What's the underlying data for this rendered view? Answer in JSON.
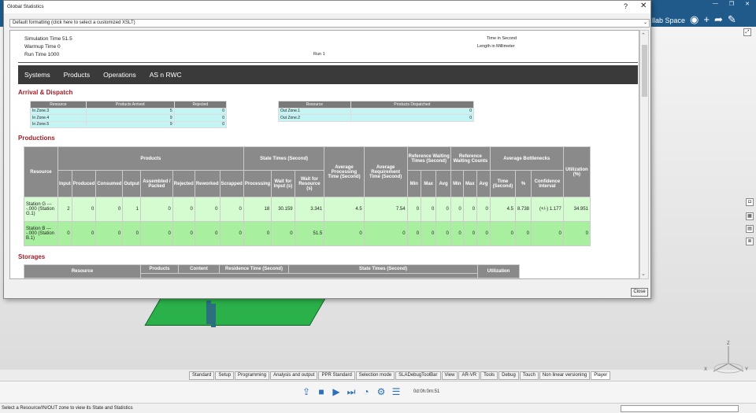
{
  "app": {
    "title_fragment": "llab Space",
    "header_icons": [
      "user-icon",
      "plus-icon",
      "share-icon",
      "tools-icon"
    ]
  },
  "dialog": {
    "title": "Global Statistics",
    "help_label": "?",
    "close_label": "✕",
    "xslt_selector": "Default formatting (click here to select a customized XSLT)",
    "close_button": "Close"
  },
  "report": {
    "simulation_time": "Simulation Time 51.5",
    "warmup_time": "Warmup Time 0",
    "run_time": "Run Time 1000",
    "run": "Run 1",
    "time_unit": "Time in Second",
    "length_unit": "Length in Millimeter",
    "nav": [
      "Systems",
      "Products",
      "Operations",
      "AS n RWC"
    ],
    "sections": {
      "arrival": "Arrival & Dispatch",
      "productions": "Productions",
      "storages": "Storages"
    },
    "arrival_table": {
      "headers": [
        "Resource",
        "Products Arrived",
        "Rejected"
      ],
      "rows": [
        [
          "In Zone.3",
          "5",
          "0"
        ],
        [
          "In Zone.4",
          "9",
          "0"
        ],
        [
          "In Zone.5",
          "9",
          "0"
        ]
      ]
    },
    "dispatch_table": {
      "headers": [
        "Resource",
        "Products Dispatched"
      ],
      "rows": [
        [
          "Out Zone.1",
          "0"
        ],
        [
          "Out Zone.2",
          "0"
        ]
      ]
    },
    "production_table": {
      "group_headers": {
        "resource": "Resource",
        "products": "Products",
        "state_times": "State Times (Second)",
        "avg_processing": "Average Processing Time (Second)",
        "avg_requirement": "Average Requirement Time (Second)",
        "ref_wait_times": "Reference Waiting Times (Second)",
        "ref_wait_counts": "Reference Waiting Counts",
        "avg_bottlenecks": "Average Bottlenecks",
        "utilization": "Utilization (%)"
      },
      "sub_headers": {
        "products": [
          "Input",
          "Produced",
          "Consumed",
          "Output",
          "Assembled / Packed",
          "Rejected",
          "Reworked",
          "Scrapped"
        ],
        "state_times": [
          "Processing",
          "Wait for Input (s)",
          "Wait for Resource (s)"
        ],
        "ref_wait_times": [
          "Min",
          "Max",
          "Avg"
        ],
        "ref_wait_counts": [
          "Min",
          "Max",
          "Avg"
        ],
        "avg_bottlenecks": [
          "Time (Second)",
          "%",
          "Confidence Interval"
        ]
      },
      "rows": [
        {
          "resource": "Station G ----.000 (Station G.1)",
          "products": [
            "2",
            "0",
            "0",
            "1",
            "0",
            "0",
            "0",
            "0"
          ],
          "state_times": [
            "18",
            "30.159",
            "3.341"
          ],
          "avg_processing": "4.5",
          "avg_requirement": "7.54",
          "ref_wait_times": [
            "0",
            "0",
            "0"
          ],
          "ref_wait_counts": [
            "0",
            "0",
            "0"
          ],
          "avg_bottlenecks": [
            "4.5",
            "8.738",
            "(+/-) 1.177"
          ],
          "utilization": "34.951"
        },
        {
          "resource": "Station B ----.000 (Station B.1)",
          "products": [
            "0",
            "0",
            "0",
            "0",
            "0",
            "0",
            "0",
            "0"
          ],
          "state_times": [
            "0",
            "0",
            "51.5"
          ],
          "avg_processing": "0",
          "avg_requirement": "0",
          "ref_wait_times": [
            "0",
            "0",
            "0"
          ],
          "ref_wait_counts": [
            "0",
            "0",
            "0"
          ],
          "avg_bottlenecks": [
            "0",
            "0",
            "0"
          ],
          "utilization": "0"
        }
      ]
    },
    "storage_table": {
      "headers": [
        "Resource",
        "Products",
        "Content",
        "Residence Time (Second)",
        "State Times (Second)",
        "Utilization"
      ]
    }
  },
  "bottom_tabs": [
    "Standard",
    "Setup",
    "Programming",
    "Analysis and output",
    "PPR Standard",
    "Selection mode",
    "SLADebugToolBar",
    "View",
    "AR-VR",
    "Tools",
    "Debug",
    "Touch",
    "Non linear versioning",
    "Player"
  ],
  "active_tab": "Player",
  "player": {
    "time": "0d:0h:0m:51",
    "buttons": [
      "export-icon",
      "stop-icon",
      "play-icon",
      "step-icon",
      "speed-icon",
      "settings-icon",
      "list-icon"
    ]
  },
  "status_bar": "Select a Resource/IN/OUT zone to view its State and Statistics",
  "compass_labels": [
    "Z",
    "X",
    "Y"
  ]
}
